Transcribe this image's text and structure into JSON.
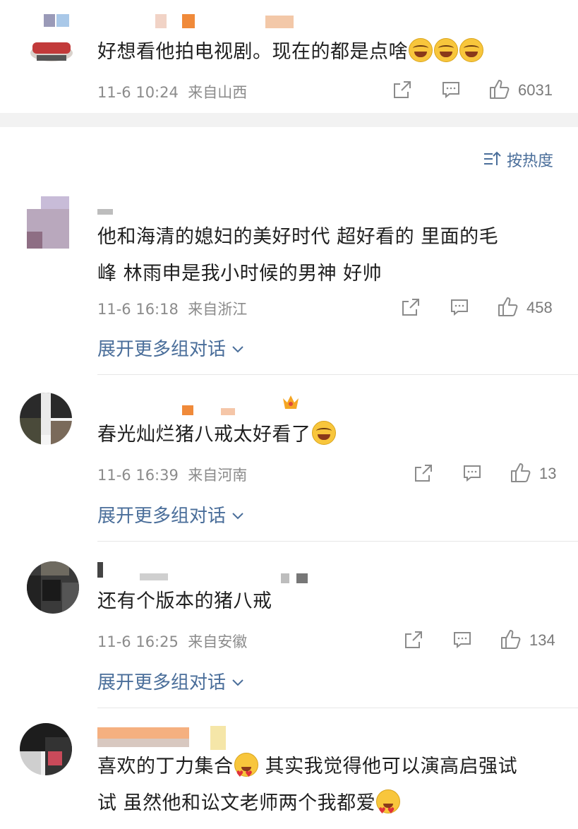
{
  "comments_top": {
    "text": "好想看他拍电视剧。现在的都是点啥",
    "time": "11-6 10:24",
    "location": "来自山西",
    "likes": "6031"
  },
  "sort": {
    "label": "按热度"
  },
  "comments": [
    {
      "text_line1": "他和海清的媳妇的美好时代  超好看的   里面的毛",
      "text_line2": "峰 林雨申是我小时候的男神  好帅",
      "time": "11-6 16:18",
      "location": "来自浙江",
      "likes": "458",
      "expand": "展开更多组对话"
    },
    {
      "text_line1": "春光灿烂猪八戒太好看了",
      "time": "11-6 16:39",
      "location": "来自河南",
      "likes": "13",
      "expand": "展开更多组对话"
    },
    {
      "text_line1": "还有个版本的猪八戒",
      "time": "11-6 16:25",
      "location": "来自安徽",
      "likes": "134",
      "expand": "展开更多组对话"
    },
    {
      "text_line1": "喜欢的丁力集合",
      "text_line1b": " 其实我觉得他可以演高启强试",
      "text_line2": "试 虽然他和讼文老师两个我都爱"
    }
  ],
  "colors": {
    "link": "#4a6e9a",
    "meta": "#8b8b8b",
    "section_gap": "#f2f2f2"
  },
  "icons": [
    "share-icon",
    "comment-icon",
    "like-icon",
    "chevron-down-icon",
    "sort-icon",
    "vip-crown-icon"
  ]
}
